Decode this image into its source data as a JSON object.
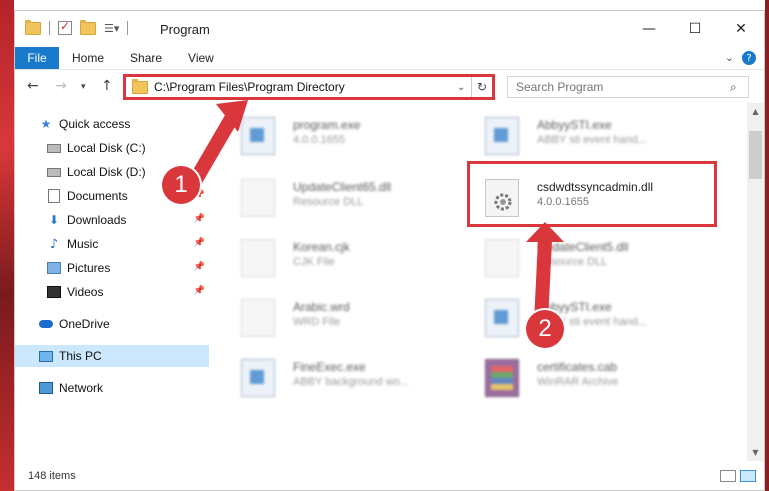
{
  "window": {
    "title": "Program"
  },
  "ribbon": {
    "tabs": [
      "File",
      "Home",
      "Share",
      "View"
    ]
  },
  "navigation": {
    "address": "C:\\Program Files\\Program Directory",
    "search_placeholder": "Search Program"
  },
  "sidebar": {
    "items": [
      {
        "label": "Quick access",
        "icon": "star-icon"
      },
      {
        "label": "Local Disk (C:)",
        "icon": "drive-icon"
      },
      {
        "label": "Local Disk (D:)",
        "icon": "drive-icon"
      },
      {
        "label": "Documents",
        "icon": "documents-icon"
      },
      {
        "label": "Downloads",
        "icon": "downloads-icon"
      },
      {
        "label": "Music",
        "icon": "music-icon"
      },
      {
        "label": "Pictures",
        "icon": "pictures-icon"
      },
      {
        "label": "Videos",
        "icon": "videos-icon"
      },
      {
        "label": "OneDrive",
        "icon": "onedrive-icon"
      },
      {
        "label": "This PC",
        "icon": "pc-icon"
      },
      {
        "label": "Network",
        "icon": "network-icon"
      }
    ]
  },
  "files": [
    {
      "name": "program.exe",
      "sub": "4.0.0.1655",
      "icon": "exe-icon"
    },
    {
      "name": "AbbyySTI.exe",
      "sub": "ABBY sti event hand...",
      "icon": "exe-icon"
    },
    {
      "name": "UpdateClient65.dll",
      "sub": "Resource DLL",
      "icon": "dll-icon"
    },
    {
      "name": "csdwdtssyncadmin.dll",
      "sub": "4.0.0.1655",
      "icon": "gear-dll-icon"
    },
    {
      "name": "Korean.cjk",
      "sub": "CJK File",
      "icon": "file-icon"
    },
    {
      "name": "UpdateClient5.dll",
      "sub": "Resource DLL",
      "icon": "dll-icon"
    },
    {
      "name": "Arabic.wrd",
      "sub": "WRD File",
      "icon": "file-icon"
    },
    {
      "name": "AbbyySTI.exe",
      "sub": "ABBY sti event hand...",
      "icon": "exe-icon"
    },
    {
      "name": "FineExec.exe",
      "sub": "ABBY background wo...",
      "icon": "exe-icon"
    },
    {
      "name": "certificates.cab",
      "sub": "WinRAR Archive",
      "icon": "archive-icon"
    }
  ],
  "callouts": [
    "1",
    "2"
  ],
  "status": {
    "items_count": "148 items"
  },
  "colors": {
    "accent": "#1979ca",
    "highlight": "#d9373c",
    "selected": "#cce8ff"
  }
}
